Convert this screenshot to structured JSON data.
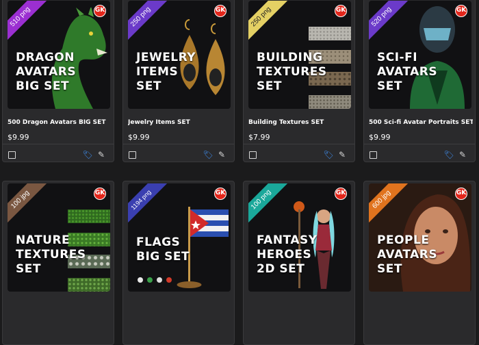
{
  "products": [
    {
      "badge": "510 png",
      "badge_color": "#9b2fd1",
      "thumb_title": "DRAGON\nAVATARS\nBIG SET",
      "name": "500 Dragon Avatars BIG SET",
      "price": "$9.99",
      "logo": "GK",
      "has_tag": true,
      "art": "dragon"
    },
    {
      "badge": "250 png",
      "badge_color": "#6b3ac9",
      "thumb_title": "JEWELRY\nITEMS\nSET",
      "name": "Jewelry Items SET",
      "price": "$9.99",
      "logo": "GK",
      "has_tag": true,
      "art": "earrings"
    },
    {
      "badge": "250 png",
      "badge_color": "#e4d064",
      "thumb_title": "BUILDING\nTEXTURES\nSET",
      "name": "Building Textures SET",
      "price": "$7.99",
      "logo": "GK",
      "has_tag": true,
      "art": "stone"
    },
    {
      "badge": "520 png",
      "badge_color": "#6b3ac9",
      "thumb_title": "SCI-FI\nAVATARS\nSET",
      "name": "500 Sci-fi Avatar Portraits SET",
      "price": "$9.99",
      "logo": "GK",
      "has_tag": true,
      "art": "scifi"
    },
    {
      "badge": "100 jpg",
      "badge_color": "#7a5741",
      "thumb_title": "NATURE\nTEXTURES\nSET",
      "logo": "GK",
      "art": "grass"
    },
    {
      "badge": "1194 png",
      "badge_color": "#3a3fb0",
      "thumb_title": "FLAGS\nBIG SET",
      "logo": "GK",
      "art": "flag"
    },
    {
      "badge": "100 png",
      "badge_color": "#1aa89a",
      "thumb_title": "FANTASY\nHEROES\n2D SET",
      "logo": "GK",
      "art": "hero"
    },
    {
      "badge": "600 jpg",
      "badge_color": "#e0731e",
      "thumb_title": "PEOPLE\nAVATARS\nSET",
      "logo": "GK",
      "art": "portrait"
    }
  ],
  "icons": {
    "select": "checkbox-icon",
    "tag": "tag-icon",
    "edit": "pencil-icon"
  }
}
